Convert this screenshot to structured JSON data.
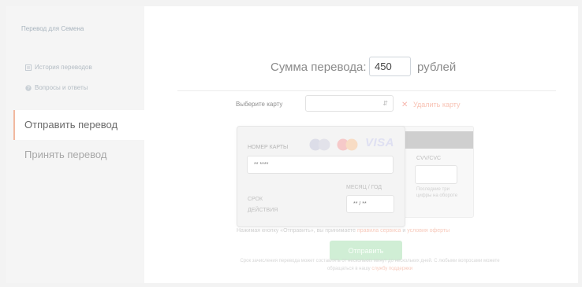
{
  "sidebar": {
    "header": "Перевод для Семена",
    "links": [
      {
        "label": "История переводов",
        "icon": "history-icon"
      },
      {
        "label": "Вопросы и ответы",
        "icon": "question-icon"
      }
    ],
    "tabs": [
      {
        "label": "Отправить перевод",
        "active": true
      },
      {
        "label": "Принять перевод",
        "active": false
      }
    ]
  },
  "amount": {
    "label": "Сумма перевода:",
    "value": "450",
    "unit": "рублей"
  },
  "card_select": {
    "label": "Выберите карту",
    "value": "",
    "delete_label": "Удалить карту"
  },
  "card": {
    "number_label": "НОМЕР КАРТЫ",
    "number_placeholder": "** ****",
    "expiry_label_1": "СРОК",
    "expiry_label_2": "ДЕЙСТВИЯ",
    "expiry_format_label": "МЕСЯЦ / ГОД",
    "expiry_placeholder": "** / **",
    "cvv_label": "CVV/CVC",
    "cvv_hint": "Последние три цифры на обороте",
    "logos": [
      "maestro",
      "mastercard",
      "VISA"
    ]
  },
  "terms": {
    "prefix": "Нажимая кнопку «Отправить», вы принимаете",
    "link1": "правила сервиса",
    "middle": "и",
    "link2": "условия оферты"
  },
  "send_button": "Отправить",
  "footer": {
    "line1": "Срок зачисления перевода может составлять от нескольких минут до нескольких дней. С любыми вопросами можете",
    "line2_prefix": "обращаться в нашу",
    "line2_link": "службу поддержки"
  },
  "colors": {
    "accent": "#f2b8a0",
    "button": "#d0eed5",
    "link": "#f7c9bb"
  }
}
